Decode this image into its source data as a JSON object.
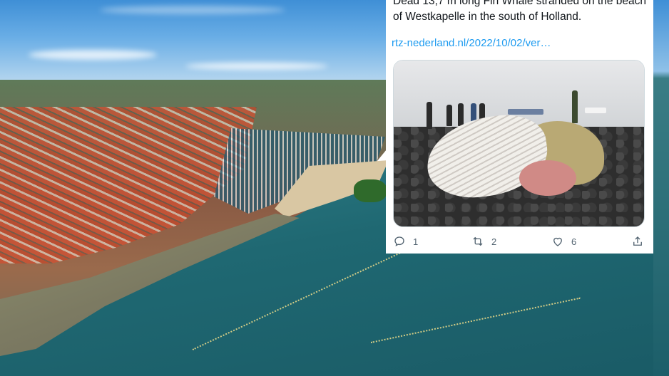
{
  "tweet": {
    "text": "Dead 13,7 m long Fin Whale stranded on the beach of Westkapelle in the south of Holland.",
    "link": "rtz-nederland.nl/2022/10/02/ver…",
    "actions": {
      "reply_count": "1",
      "retweet_count": "2",
      "like_count": "6"
    },
    "icons": [
      "reply-icon",
      "retweet-icon",
      "like-icon",
      "share-icon"
    ]
  },
  "colors": {
    "link": "#1d9bf0",
    "text": "#0f1419",
    "muted": "#536471"
  }
}
